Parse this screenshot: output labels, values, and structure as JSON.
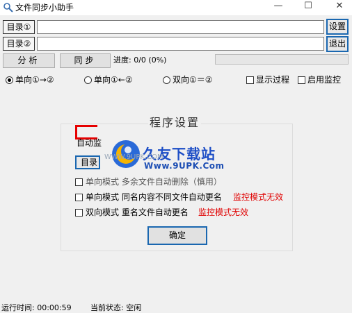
{
  "window": {
    "title": "文件同步小助手",
    "minimize": "—",
    "maximize": "☐",
    "close": "✕"
  },
  "dirs": [
    {
      "label": "目录①",
      "value": ""
    },
    {
      "label": "目录②",
      "value": ""
    }
  ],
  "buttons": {
    "settings": "设置",
    "exit": "退出",
    "analyze": "分析",
    "sync": "同步"
  },
  "progress": {
    "label": "进度: 0/0 (0%)",
    "fraction": 0
  },
  "modes": [
    {
      "label": "单向①→②",
      "selected": true
    },
    {
      "label": "单向①←②",
      "selected": false
    },
    {
      "label": "双向①＝②",
      "selected": false
    }
  ],
  "checks": {
    "show_process": "显示过程",
    "enable_monitor": "启用监控"
  },
  "settings_panel": {
    "title": "程序设置",
    "auto_label": "自动监",
    "dir_button": "目录",
    "opt1": "单向模式  多余文件自动删除（慎用）",
    "opt2": "单向模式  同名内容不同文件自动更名",
    "opt2_note": "监控模式无效",
    "opt3": "双向模式  重名文件自动更名",
    "opt3_note": "监控模式无效",
    "ok": "确定"
  },
  "watermark": {
    "name": "久友下载站",
    "site": "Www.9UPK.Com",
    "faint": "WWW.9UPK.COM"
  },
  "status": {
    "runtime": "运行时间:  00:00:59",
    "state": "当前状态: 空闲"
  },
  "colors": {
    "accent_border": "#1a67b0",
    "warning_text": "#e00000",
    "watermark_blue": "#1d4ec6"
  }
}
